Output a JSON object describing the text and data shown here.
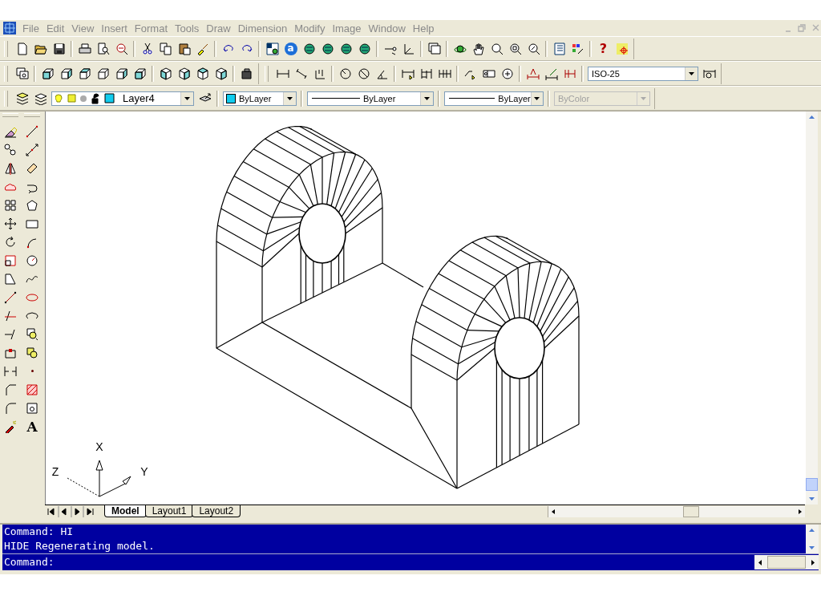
{
  "menu": [
    "File",
    "Edit",
    "View",
    "Insert",
    "Format",
    "Tools",
    "Draw",
    "Dimension",
    "Modify",
    "Image",
    "Window",
    "Help"
  ],
  "standard_toolbar": {
    "a_glyph": "a",
    "help_glyph": "?"
  },
  "dimension_toolbar": {
    "dim_style": "ISO-25"
  },
  "properties_toolbar": {
    "layer": "Layer4",
    "color_value": "ByLayer",
    "linetype": "ByLayer",
    "lineweight": "ByLayer",
    "plot_style": {
      "value": "ByColor",
      "disabled": true
    }
  },
  "draw_toolbar": {
    "text_glyph": "A"
  },
  "ucs": {
    "x": "X",
    "y": "Y",
    "z": "Z"
  },
  "layout_tabs": [
    {
      "label": "Model",
      "selected": true
    },
    {
      "label": "Layout1",
      "selected": false
    },
    {
      "label": "Layout2",
      "selected": false
    }
  ],
  "command_window": {
    "history": [
      "Command: HI",
      "HIDE Regenerating model."
    ],
    "prompt": "Command:"
  }
}
